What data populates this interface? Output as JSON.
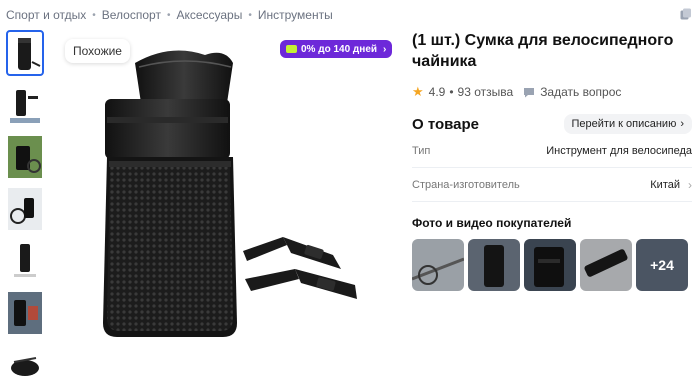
{
  "breadcrumb": [
    "Спорт и отдых",
    "Велоспорт",
    "Аксессуары",
    "Инструменты"
  ],
  "gallery": {
    "similar_label": "Похожие",
    "installment_label": "0% до 140 дней"
  },
  "product": {
    "title": "(1 шт.) Сумка для велосипедного чайника",
    "rating": "4.9",
    "reviews": "93 отзыва",
    "ask_question": "Задать вопрос"
  },
  "about": {
    "title": "О товаре",
    "go_description": "Перейти к описанию",
    "specs": [
      {
        "key": "Тип",
        "value": "Инструмент для велосипеда"
      },
      {
        "key": "Страна-изготовитель",
        "value": "Китай"
      }
    ]
  },
  "buyer_photos": {
    "title": "Фото и видео покупателей",
    "more_label": "+24"
  },
  "colors": {
    "accent": "#2563eb",
    "badge": "#6d28d9",
    "star": "#f5a623"
  }
}
